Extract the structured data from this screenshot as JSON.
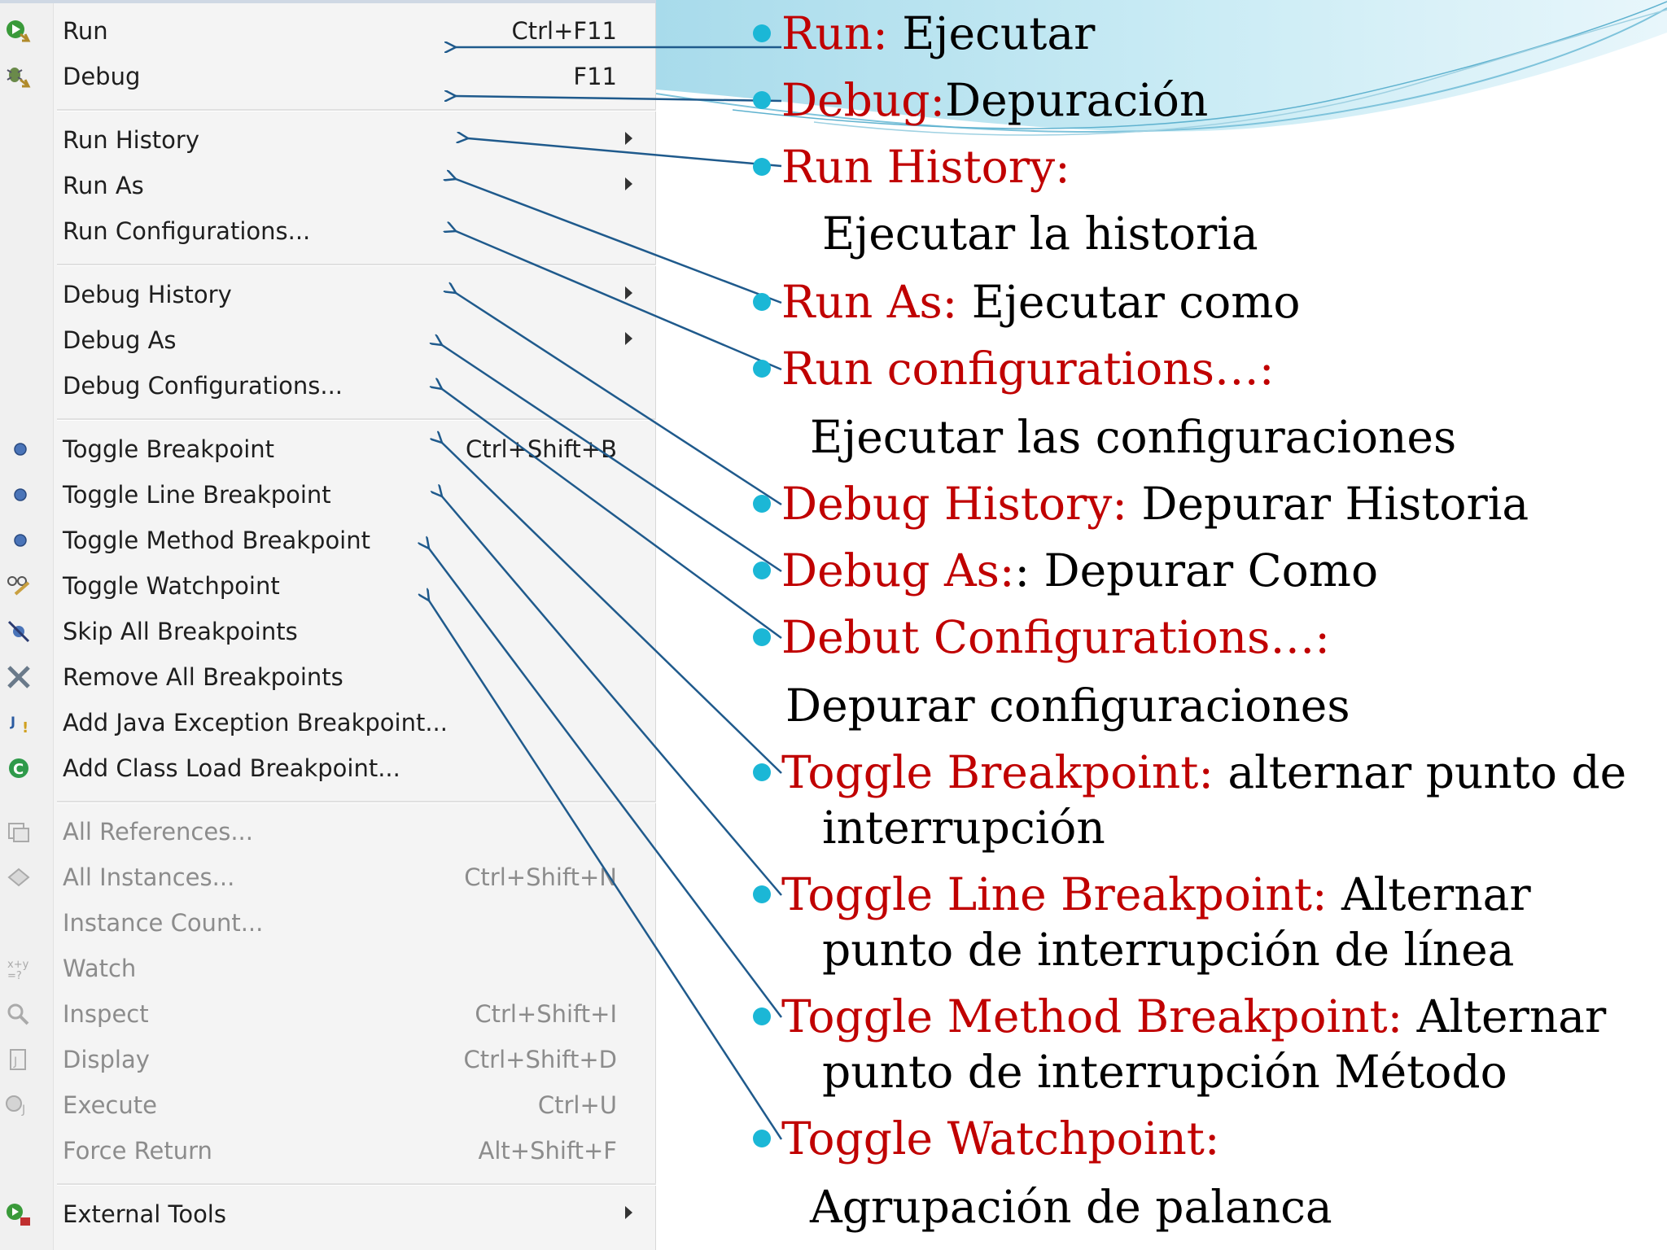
{
  "menu": {
    "items": [
      {
        "label": "Run",
        "shortcut": "Ctrl+F11",
        "icon": "run-icon"
      },
      {
        "label": "Debug",
        "shortcut": "F11",
        "icon": "debug-bug-icon"
      },
      {
        "label": "Run History",
        "icon": "submenu-arrow"
      },
      {
        "label": "Run As",
        "icon": "submenu-arrow"
      },
      {
        "label": "Run Configurations..."
      },
      {
        "label": "Debug History",
        "icon": "submenu-arrow"
      },
      {
        "label": "Debug As",
        "icon": "submenu-arrow"
      },
      {
        "label": "Debug Configurations..."
      },
      {
        "label": "Toggle Breakpoint",
        "shortcut": "Ctrl+Shift+B",
        "icon": "breakpoint-dot-icon"
      },
      {
        "label": "Toggle Line Breakpoint",
        "icon": "breakpoint-dot-icon"
      },
      {
        "label": "Toggle Method Breakpoint",
        "icon": "breakpoint-dot-icon"
      },
      {
        "label": "Toggle Watchpoint",
        "icon": "watchpoint-glasses-icon"
      },
      {
        "label": "Skip All Breakpoints",
        "icon": "skip-breakpoints-icon"
      },
      {
        "label": "Remove All Breakpoints",
        "icon": "remove-breakpoints-icon"
      },
      {
        "label": "Add Java Exception Breakpoint...",
        "icon": "java-exception-icon"
      },
      {
        "label": "Add Class Load Breakpoint...",
        "icon": "class-load-icon"
      },
      {
        "label": "All References...",
        "icon": "references-icon"
      },
      {
        "label": "All Instances...",
        "shortcut": "Ctrl+Shift+N",
        "icon": "instances-icon"
      },
      {
        "label": "Instance Count..."
      },
      {
        "label": "Watch",
        "icon": "watch-expression-icon"
      },
      {
        "label": "Inspect",
        "shortcut": "Ctrl+Shift+I",
        "icon": "inspect-magnifier-icon"
      },
      {
        "label": "Display",
        "shortcut": "Ctrl+Shift+D",
        "icon": "display-icon"
      },
      {
        "label": "Execute",
        "shortcut": "Ctrl+U",
        "icon": "execute-icon"
      },
      {
        "label": "Force Return",
        "shortcut": "Alt+Shift+F"
      },
      {
        "label": "External Tools",
        "icon": "external-tools-icon"
      }
    ]
  },
  "notes": [
    {
      "term": "Run:",
      "desc": " Ejecutar"
    },
    {
      "term": "Debug:",
      "desc": "Depuración"
    },
    {
      "term": "Run History:",
      "desc": ""
    },
    {
      "term": "Run As:",
      "desc": " Ejecutar como"
    },
    {
      "term": "Run configurations…:",
      "desc": ""
    },
    {
      "term": "Debug History:",
      "desc": " Depurar Historia"
    },
    {
      "term": "Debug  As:",
      "desc": ": Depurar Como"
    },
    {
      "term": "Debut Configurations…:",
      "desc": ""
    },
    {
      "term": "Toggle Breakpoint:",
      "desc": " alternar punto de"
    },
    {
      "term": "Toggle Line Breakpoint:",
      "desc": " Alternar"
    },
    {
      "term": "Toggle Method Breakpoint:",
      "desc": " Alternar"
    },
    {
      "term": "Toggle Watchpoint:",
      "desc": ""
    }
  ],
  "continuations": [
    "Ejecutar la historia",
    "Ejecutar las configuraciones",
    "Depurar configuraciones",
    "interrupción",
    "punto de interrupción de línea",
    "punto de interrupción Método",
    "Agrupación de palanca"
  ],
  "colors": {
    "term_color": "#c00000",
    "desc_color": "#000000",
    "bullet_color": "#1bb7d6",
    "arrow_color": "#1f5a8c",
    "menu_bg": "#f4f4f4",
    "disabled_text": "#8c8c8c"
  }
}
